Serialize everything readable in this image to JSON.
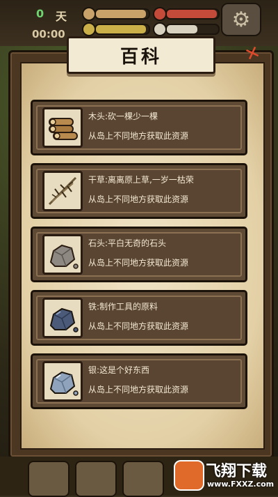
{
  "hud": {
    "day_number": "0",
    "day_label": "天",
    "clock": "00:00",
    "stats": [
      {
        "name": "hunger",
        "level": 0.95,
        "color": "#c9a26a"
      },
      {
        "name": "health",
        "level": 0.97,
        "color": "#c44a3a"
      },
      {
        "name": "thirst",
        "level": 0.95,
        "color": "#cbb04a"
      },
      {
        "name": "sanity",
        "level": 0.6,
        "color": "#d9d2c0"
      }
    ]
  },
  "panel": {
    "title": "百科",
    "items": [
      {
        "name": "木头:砍一棵少一棵",
        "desc": "从岛上不同地方获取此资源",
        "icon": "wood-logs-icon"
      },
      {
        "name": "干草:离离原上草,一岁一枯荣",
        "desc": "从岛上不同地方获取此资源",
        "icon": "hay-icon"
      },
      {
        "name": "石头:平白无奇的石头",
        "desc": "从岛上不同地方获取此资源",
        "icon": "stone-icon"
      },
      {
        "name": "铁:制作工具的原料",
        "desc": "从岛上不同地方获取此资源",
        "icon": "iron-ore-icon"
      },
      {
        "name": "银:这是个好东西",
        "desc": "从岛上不同地方获取此资源",
        "icon": "silver-ore-icon"
      }
    ]
  },
  "watermark": {
    "text": "飞翔下载",
    "url": "www.FXXZ.com"
  }
}
